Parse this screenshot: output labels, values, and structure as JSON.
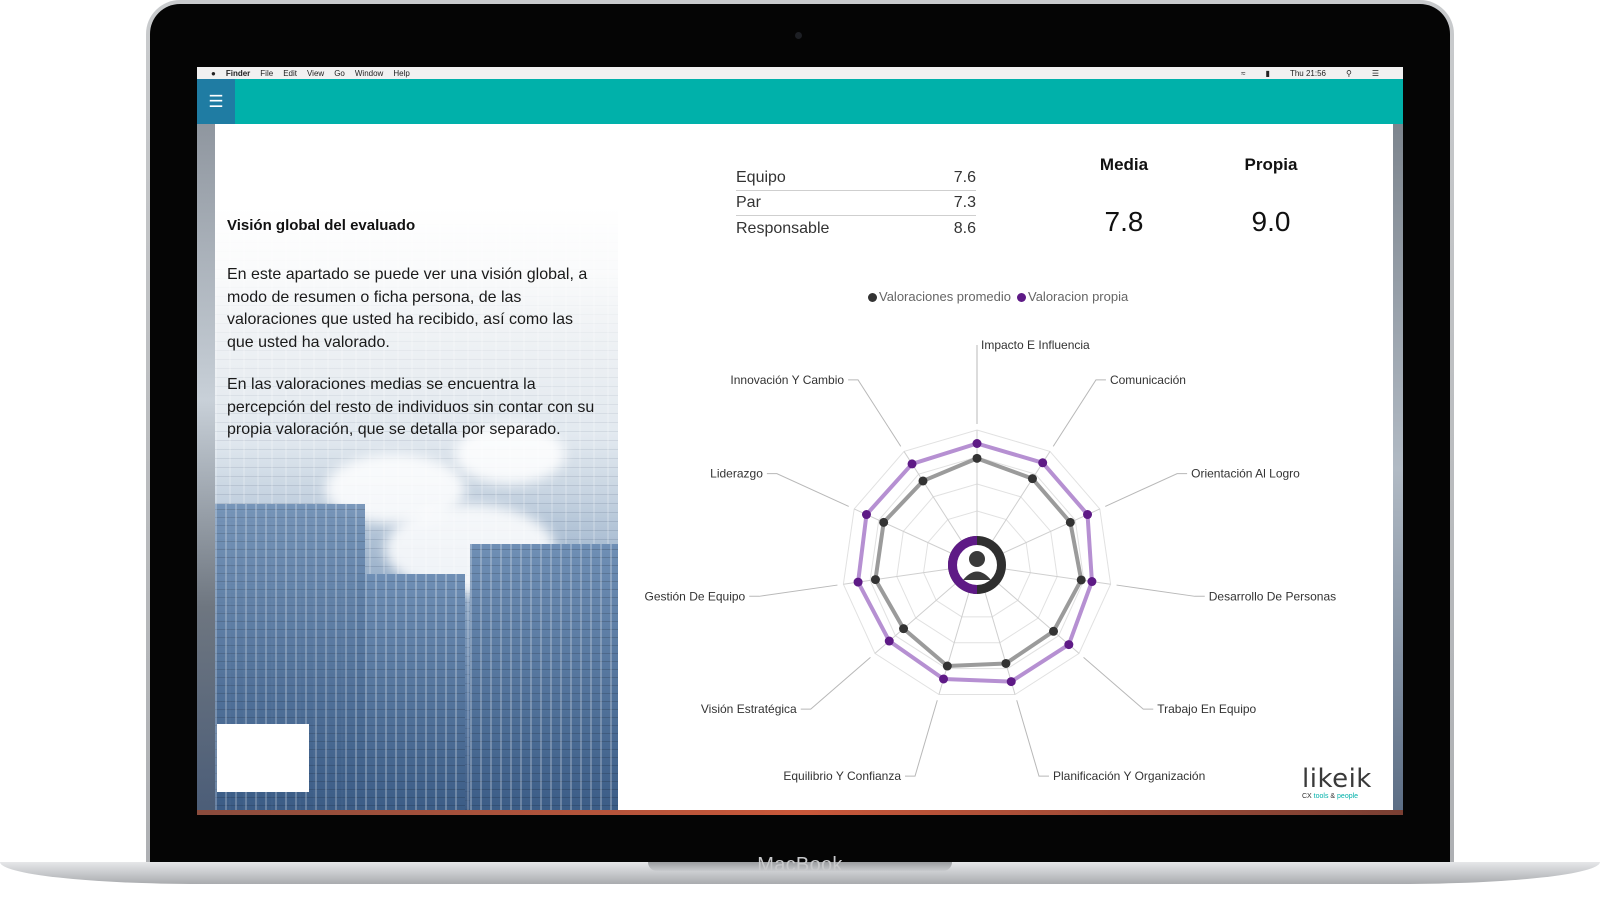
{
  "device": {
    "brand": "MacBook"
  },
  "menubar": {
    "apple": "",
    "items": [
      "Finder",
      "File",
      "Edit",
      "View",
      "Go",
      "Window",
      "Help"
    ],
    "clock": "Thu 21:56"
  },
  "panel": {
    "title": "Visión global del evaluado",
    "paragraph1": "En este apartado se puede ver una visión global, a modo de resumen o ficha persona, de las valoraciones que usted ha recibido, así como las que usted ha valorado.",
    "paragraph2": "En las valoraciones medias se encuentra la percepción del resto de individuos sin contar con su propia valoración, que se detalla por separado."
  },
  "scores": [
    {
      "label": "Equipo",
      "value": "7.6"
    },
    {
      "label": "Par",
      "value": "7.3"
    },
    {
      "label": "Responsable",
      "value": "8.6"
    }
  ],
  "summary": {
    "media_label": "Media",
    "media_value": "7.8",
    "propia_label": "Propia",
    "propia_value": "9.0"
  },
  "brand": {
    "name": "likeik",
    "tagline_a": "CX ",
    "tagline_b": "tools",
    "tagline_c": " & ",
    "tagline_d": "people"
  },
  "colors": {
    "teal": "#00b1aa",
    "menu_blue": "#1f7ca3",
    "avg_series": "#333333",
    "own_series": "#5e1a86",
    "own_line": "#b690d2",
    "avg_line": "#9b9b9b"
  },
  "chart_data": {
    "type": "radar",
    "categories": [
      "Impacto E Influencia",
      "Comunicación",
      "Orientación Al Logro",
      "Desarrollo De Personas",
      "Trabajo En Equipo",
      "Planificación Y Organización",
      "Equilibrio Y Confianza",
      "Visión Estratégica",
      "Gestión De Equipo",
      "Liderazgo",
      "Innovación Y Cambio"
    ],
    "series": [
      {
        "name": "Valoraciones promedio",
        "values": [
          7.9,
          7.6,
          7.6,
          7.8,
          7.5,
          7.6,
          7.8,
          7.2,
          7.6,
          7.6,
          7.4
        ]
      },
      {
        "name": "Valoracion propia",
        "values": [
          9.0,
          9.0,
          9.0,
          8.6,
          9.0,
          9.0,
          8.8,
          8.6,
          8.9,
          9.0,
          8.9
        ]
      }
    ],
    "rlim": [
      0,
      10
    ],
    "grid_levels": 5,
    "legend": "top"
  }
}
